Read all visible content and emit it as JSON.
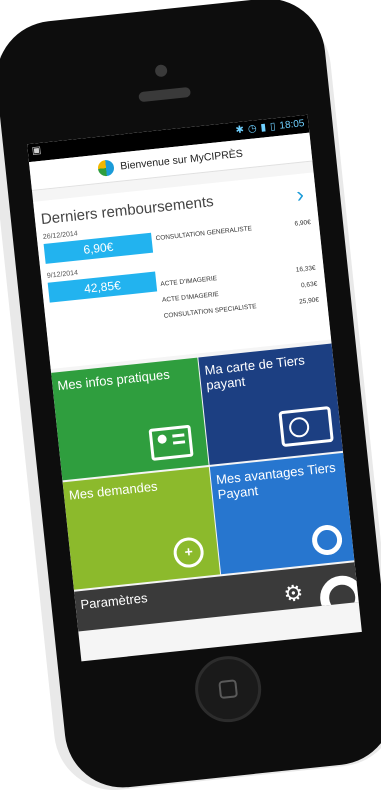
{
  "status_bar": {
    "time": "18:05"
  },
  "header": {
    "title": "Bienvenue sur MyCIPRÈS"
  },
  "remboursements": {
    "title": "Derniers remboursements",
    "groups": [
      {
        "date": "26/12/2014",
        "total": "6,90€",
        "lines": [
          {
            "label": "CONSULTATION GENERALISTE",
            "amount": "6,90€"
          }
        ]
      },
      {
        "date": "9/12/2014",
        "total": "42,85€",
        "lines": [
          {
            "label": "ACTE D'IMAGERIE",
            "amount": "16,33€"
          },
          {
            "label": "ACTE D'IMAGERIE",
            "amount": "0,63€"
          },
          {
            "label": "CONSULTATION SPECIALISTE",
            "amount": "25,90€"
          }
        ]
      }
    ]
  },
  "tiles": {
    "infos": "Mes infos pratiques",
    "carte": "Ma carte de Tiers payant",
    "demandes": "Mes demandes",
    "avantages": "Mes avantages Tiers Payant",
    "parametres": "Paramètres"
  },
  "colors": {
    "accent": "#22b3ef",
    "green": "#2f9e3e",
    "navy": "#1c3f82",
    "lime": "#8cba2c",
    "blue": "#2776cf",
    "dark": "#3a3a3a"
  }
}
